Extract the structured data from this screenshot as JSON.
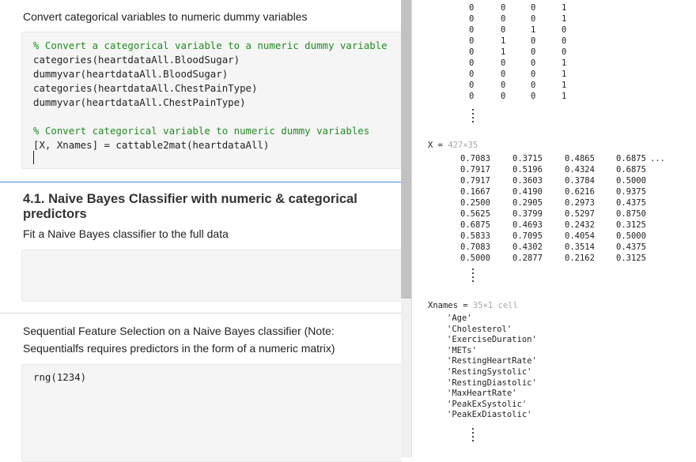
{
  "left": {
    "intro": "Convert categorical variables to numeric dummy variables",
    "code1": [
      {
        "text": "% Convert a categorical variable to a numeric dummy variable",
        "comment": true
      },
      {
        "text": "categories(heartdataAll.BloodSugar)",
        "comment": false
      },
      {
        "text": "dummyvar(heartdataAll.BloodSugar)",
        "comment": false
      },
      {
        "text": "categories(heartdataAll.ChestPainType)",
        "comment": false
      },
      {
        "text": "dummyvar(heartdataAll.ChestPainType)",
        "comment": false
      },
      {
        "text": "",
        "comment": false
      },
      {
        "text": "% Convert categorical variable to numeric dummy variables",
        "comment": true
      },
      {
        "text": "[X, Xnames] = cattable2mat(heartdataAll)",
        "comment": false
      }
    ],
    "heading": "4.1. Naive Bayes Classifier with numeric & categorical predictors",
    "fit_text": "Fit a Naive Bayes classifier to the full data",
    "seq_text_1": "Sequential Feature Selection on a Naive Bayes classifier (Note:",
    "seq_text_2": "Sequentialfs requires predictors in the form of a numeric matrix)",
    "code3": "rng(1234)"
  },
  "right": {
    "dummy_matrix": [
      [
        "0",
        "0",
        "0",
        "1"
      ],
      [
        "0",
        "0",
        "0",
        "1"
      ],
      [
        "0",
        "0",
        "1",
        "0"
      ],
      [
        "0",
        "1",
        "0",
        "0"
      ],
      [
        "0",
        "1",
        "0",
        "0"
      ],
      [
        "0",
        "0",
        "0",
        "1"
      ],
      [
        "0",
        "0",
        "0",
        "1"
      ],
      [
        "0",
        "0",
        "0",
        "1"
      ],
      [
        "0",
        "0",
        "0",
        "1"
      ]
    ],
    "x_label": "X = ",
    "x_size": "427×35",
    "x_matrix": [
      [
        "0.7083",
        "0.3715",
        "0.4865",
        "0.6875"
      ],
      [
        "0.7917",
        "0.5196",
        "0.4324",
        "0.6875"
      ],
      [
        "0.7917",
        "0.3603",
        "0.3784",
        "0.5000"
      ],
      [
        "0.1667",
        "0.4190",
        "0.6216",
        "0.9375"
      ],
      [
        "0.2500",
        "0.2905",
        "0.2973",
        "0.4375"
      ],
      [
        "0.5625",
        "0.3799",
        "0.5297",
        "0.8750"
      ],
      [
        "0.6875",
        "0.4693",
        "0.2432",
        "0.3125"
      ],
      [
        "0.5833",
        "0.7095",
        "0.4054",
        "0.5000"
      ],
      [
        "0.7083",
        "0.4302",
        "0.3514",
        "0.4375"
      ],
      [
        "0.5000",
        "0.2877",
        "0.2162",
        "0.3125"
      ]
    ],
    "x_more": "...",
    "xnames_label": "Xnames = ",
    "xnames_size": "35×1 cell",
    "xnames": [
      "'Age'",
      "'Cholesterol'",
      "'ExerciseDuration'",
      "'METs'",
      "'RestingHeartRate'",
      "'RestingSystolic'",
      "'RestingDiastolic'",
      "'MaxHeartRate'",
      "'PeakExSystolic'",
      "'PeakExDiastolic'"
    ]
  }
}
